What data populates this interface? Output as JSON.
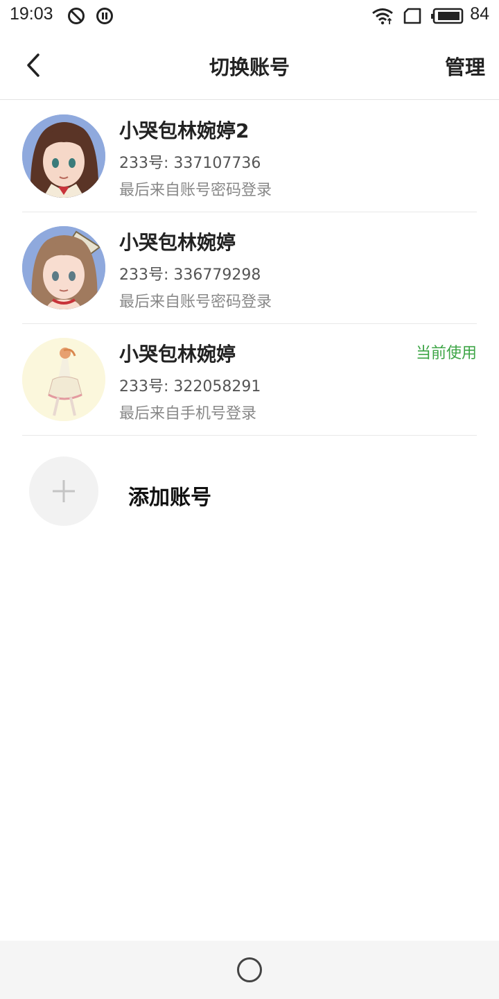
{
  "status_bar": {
    "time": "19:03",
    "battery_level": "84",
    "icons": [
      "do-not-disturb-icon",
      "pause-icon",
      "wifi-icon",
      "sim-icon",
      "battery-icon"
    ]
  },
  "nav": {
    "title": "切换账号",
    "manage_label": "管理",
    "back_icon": "chevron-left-icon"
  },
  "accounts": [
    {
      "name": "小哭包林婉婷2",
      "id_text": "233号: 337107736",
      "last_login": "最后来自账号密码登录",
      "badge": "",
      "avatar_icon": "anime-girl-avatar"
    },
    {
      "name": "小哭包林婉婷",
      "id_text": "233号: 336779298",
      "last_login": "最后来自账号密码登录",
      "badge": "",
      "avatar_icon": "anime-girl-avatar"
    },
    {
      "name": "小哭包林婉婷",
      "id_text": "233号: 322058291",
      "last_login": "最后来自手机号登录",
      "badge": "当前使用",
      "avatar_icon": "anime-girl-avatar"
    }
  ],
  "add_account": {
    "label": "添加账号",
    "icon": "plus-icon"
  },
  "colors": {
    "current_badge": "#3da546",
    "avatar_blue": "#8fa9dd",
    "avatar_cream": "#fbf7dc"
  }
}
